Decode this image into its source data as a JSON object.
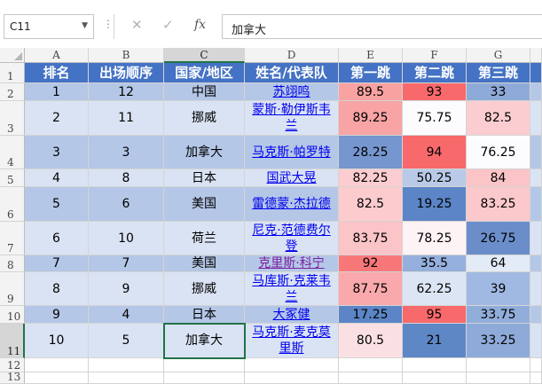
{
  "formula_bar": {
    "name_box": "C11",
    "dots": "⋮",
    "cancel_icon": "✕",
    "enter_icon": "✓",
    "fx_label": "fx",
    "content": "加拿大"
  },
  "columns": [
    "A",
    "B",
    "C",
    "D",
    "E",
    "F",
    "G",
    ""
  ],
  "rows": [
    "1",
    "2",
    "3",
    "4",
    "5",
    "6",
    "7",
    "8",
    "9",
    "10",
    "11",
    "12",
    "13"
  ],
  "colors": {
    "header_fill": "#4472c4",
    "band_dark": "#b4c7e7",
    "band_light": "#dae3f3",
    "selection": "#217346"
  },
  "table": {
    "headers": [
      "排名",
      "出场顺序",
      "国家/地区",
      "姓名/代表队",
      "第一跳",
      "第二跳",
      "第三跳",
      ""
    ],
    "rows": [
      {
        "rank": "1",
        "order": "12",
        "country": "中国",
        "name": "苏翊鸣",
        "j1": "89.5",
        "j2": "93",
        "j3": "33",
        "c1": "#f8a2a2",
        "c2": "#f8696b",
        "c3": "#8eaad9",
        "visited": false
      },
      {
        "rank": "2",
        "order": "11",
        "country": "挪威",
        "name": "蒙斯·勒伊斯韦兰",
        "j1": "89.25",
        "j2": "75.75",
        "j3": "82.5",
        "c1": "#f8a4a4",
        "c2": "#fcfcff",
        "c3": "#fbcdd0",
        "visited": false
      },
      {
        "rank": "3",
        "order": "3",
        "country": "加拿大",
        "name": "马克斯·帕罗特",
        "j1": "28.25",
        "j2": "94",
        "j3": "76.25",
        "c1": "#7596cf",
        "c2": "#f8696b",
        "c3": "#fcfcff",
        "visited": false
      },
      {
        "rank": "4",
        "order": "8",
        "country": "日本",
        "name": "国武大晃",
        "j1": "82.25",
        "j2": "50.25",
        "j3": "84",
        "c1": "#fbcdd0",
        "c2": "#b9cae8",
        "c3": "#fbc4c6",
        "visited": false
      },
      {
        "rank": "5",
        "order": "6",
        "country": "美国",
        "name": "雷德蒙·杰拉德",
        "j1": "82.5",
        "j2": "19.25",
        "j3": "83.25",
        "c1": "#fbcbce",
        "c2": "#5b85c6",
        "c3": "#fbc9cb",
        "visited": false
      },
      {
        "rank": "6",
        "order": "10",
        "country": "荷兰",
        "name": "尼克·范德费尔登",
        "j1": "83.75",
        "j2": "78.25",
        "j3": "26.75",
        "c1": "#fbc4c7",
        "c2": "#fdf2f4",
        "c3": "#6b8ecb",
        "visited": false
      },
      {
        "rank": "7",
        "order": "7",
        "country": "美国",
        "name": "克里斯·科宁",
        "j1": "92",
        "j2": "35.5",
        "j3": "64",
        "c1": "#f8787a",
        "c2": "#95b0dd",
        "c3": "#e3ebf7",
        "visited": true
      },
      {
        "rank": "8",
        "order": "9",
        "country": "挪威",
        "name": "马库斯·克莱韦兰",
        "j1": "87.75",
        "j2": "62.25",
        "j3": "39",
        "c1": "#f9a9ab",
        "c2": "#dce5f4",
        "c3": "#a0b9e2",
        "visited": false
      },
      {
        "rank": "9",
        "order": "4",
        "country": "日本",
        "name": "大冢健",
        "j1": "17.25",
        "j2": "95",
        "j3": "33.75",
        "c1": "#5b85c6",
        "c2": "#f8696b",
        "c3": "#91add9",
        "visited": false
      },
      {
        "rank": "10",
        "order": "5",
        "country": "加拿大",
        "name": "马克斯·麦克莫里斯",
        "j1": "80.5",
        "j2": "21",
        "j3": "33.25",
        "c1": "#fbe0e3",
        "c2": "#5e87c6",
        "c3": "#8eaad9",
        "visited": false
      }
    ]
  }
}
